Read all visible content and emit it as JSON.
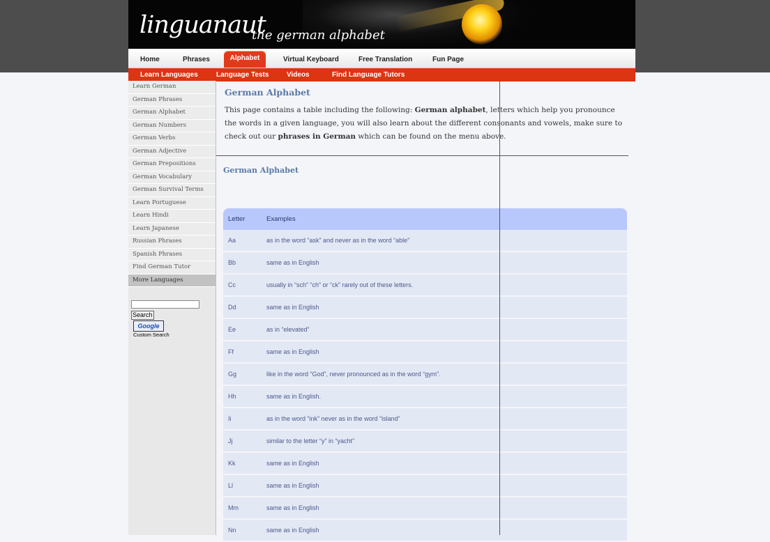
{
  "header": {
    "logo": "linguanaut",
    "subtitle": "the german alphabet"
  },
  "nav": {
    "tabs": [
      {
        "label": "Home",
        "active": false
      },
      {
        "label": "Phrases",
        "active": false
      },
      {
        "label": "Alphabet",
        "active": true
      },
      {
        "label": "Virtual Keyboard",
        "active": false
      },
      {
        "label": "Free Translation",
        "active": false
      },
      {
        "label": "Fun Page",
        "active": false
      }
    ]
  },
  "subnav": {
    "items": [
      "Learn Languages",
      "Language Tests",
      "Videos",
      "Find Language Tutors"
    ]
  },
  "sidebar": {
    "items": [
      "Learn German",
      "German Phrases",
      "German Alphabet",
      "German Numbers",
      "German Verbs",
      "German Adjective",
      "German Prepositions",
      "German Vocabulary",
      "German Survival Terms",
      "Learn Portuguese",
      "Learn Hindi",
      "Learn Japanese",
      "Russian Phrases",
      "Spanish Phrases",
      "Find German Tutor",
      "More Languages"
    ],
    "active_index": 15,
    "search_button": "Search",
    "google_logo": "Google",
    "custom_search": "Custom Search"
  },
  "main": {
    "title": "German Alphabet",
    "intro": {
      "p1": "This page contains a table including the following: ",
      "b1": "German alphabet",
      "p2": ", letters which help you pronounce the words in a given language, you will also learn about the different consonants and vowels, make sure to check out our ",
      "b2": "phrases in German",
      "p3": " which can be found on the menu above."
    },
    "section_title": "German Alphabet",
    "table": {
      "headers": [
        "Letter",
        "Examples"
      ],
      "rows": [
        [
          "Aa",
          "as in the word “ask” and never as in the word “able”"
        ],
        [
          "Bb",
          "same as in English"
        ],
        [
          "Cc",
          "usually in “sch” “ch” or “ck” rarely out of these letters."
        ],
        [
          "Dd",
          "same as in English"
        ],
        [
          "Ee",
          "as in “elevated”"
        ],
        [
          "Ff",
          "same as in English"
        ],
        [
          "Gg",
          "like in the word “God”, never pronounced as in the word “gym”."
        ],
        [
          "Hh",
          "same as in English."
        ],
        [
          "Ii",
          "as in the word “ink” never as in the word “island”"
        ],
        [
          "Jj",
          "similar to the letter “y” in “yacht”"
        ],
        [
          "Kk",
          "same as in English"
        ],
        [
          "Ll",
          "same as in English"
        ],
        [
          "Mm",
          "same as in English"
        ],
        [
          "Nn",
          "same as in English"
        ]
      ]
    }
  }
}
